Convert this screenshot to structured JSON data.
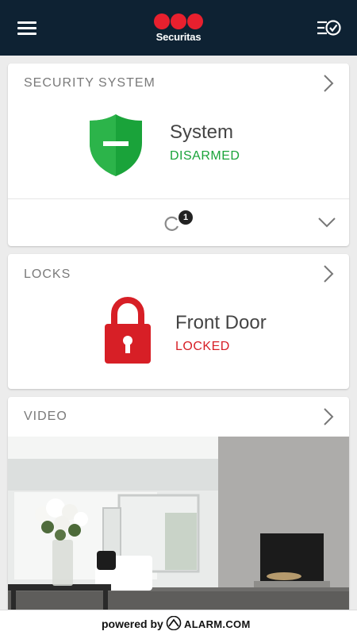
{
  "header": {
    "brand": "Securitas",
    "menu_icon": "hamburger-menu-icon",
    "right_icon": "list-check-icon"
  },
  "security": {
    "title": "SECURITY SYSTEM",
    "name": "System",
    "state": "DISARMED",
    "state_color": "#1aa33a",
    "badge_count": "1"
  },
  "locks": {
    "title": "LOCKS",
    "name": "Front Door",
    "state": "LOCKED",
    "state_color": "#d71f26"
  },
  "video": {
    "title": "VIDEO"
  },
  "footer": {
    "powered_by": "powered by",
    "provider": "ALARM.COM"
  }
}
